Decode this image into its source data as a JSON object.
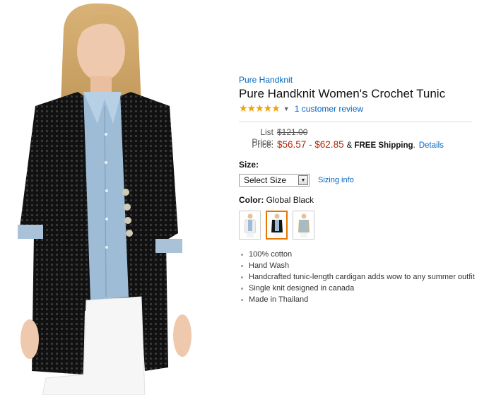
{
  "product": {
    "brand": "Pure Handknit",
    "title": "Pure Handknit Women's Crochet Tunic",
    "stars": "★★★★★",
    "review_link": "1 customer review"
  },
  "pricing": {
    "list_price_label": "List Price:",
    "list_price": "$121.00",
    "price_label": "Price:",
    "price_range": "$56.57 - $62.85",
    "shipping_prefix": "&",
    "shipping_text": "FREE Shipping",
    "shipping_suffix": ".",
    "details_link": "Details",
    "price_color": "#b12704",
    "link_color": "#0066c0"
  },
  "size": {
    "label": "Size:",
    "selected": "Select Size",
    "sizing_link": "Sizing info"
  },
  "color": {
    "label": "Color:",
    "selected": "Global Black",
    "swatches": [
      "white",
      "black",
      "gray"
    ],
    "selected_index": 1
  },
  "features": [
    "100% cotton",
    "Hand Wash",
    "Handcrafted tunic-length cardigan adds wow to any summer outfit",
    "Single knit designed in canada",
    "Made in Thailand"
  ],
  "icons": {
    "dropdown": "chevron-down-icon",
    "stars": "star-icon"
  }
}
